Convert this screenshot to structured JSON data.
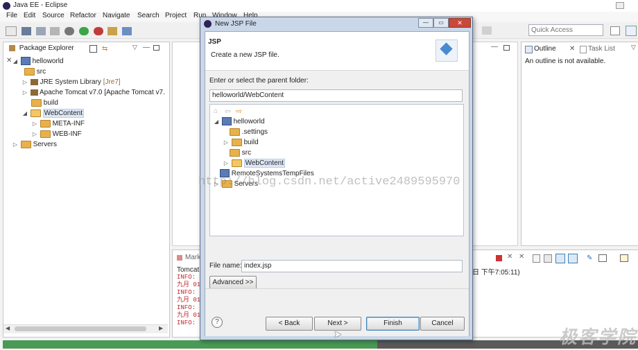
{
  "window": {
    "title": "Java EE - Eclipse"
  },
  "menu": [
    "File",
    "Edit",
    "Source",
    "Refactor",
    "Navigate",
    "Search",
    "Project",
    "Run",
    "Window",
    "Help"
  ],
  "quick_access": {
    "placeholder": "Quick Access"
  },
  "package_explorer": {
    "tab_label": "Package Explorer",
    "tree": [
      {
        "label": "helloworld",
        "suffix": ""
      },
      {
        "label": "src",
        "suffix": ""
      },
      {
        "label": "JRE System Library",
        "suffix": "[Jre7]"
      },
      {
        "label": "Apache Tomcat v7.0 [Apache Tomcat v7.",
        "suffix": ""
      },
      {
        "label": "build",
        "suffix": ""
      },
      {
        "label": "WebContent",
        "suffix": ""
      },
      {
        "label": "META-INF",
        "suffix": ""
      },
      {
        "label": "WEB-INF",
        "suffix": ""
      },
      {
        "label": "Servers",
        "suffix": ""
      }
    ]
  },
  "outline": {
    "tab_label": "Outline",
    "task_tab_label": "Task List",
    "message": "An outline is not available."
  },
  "console": {
    "tab_label": "Mark",
    "header": "Tomcat",
    "header_right": "日 下午7:05:11)",
    "lines": [
      "INFO:",
      "九月 01,",
      "INFO:",
      "九月 01,",
      "INFO:",
      "九月 01,",
      "INFO:"
    ]
  },
  "dialog": {
    "title": "New JSP File",
    "heading": "JSP",
    "subheading": "Create a new JSP file.",
    "folder_label": "Enter or select the parent folder:",
    "folder_value": "helloworld/WebContent",
    "tree": [
      {
        "label": "helloworld"
      },
      {
        "label": ".settings"
      },
      {
        "label": "build"
      },
      {
        "label": "src"
      },
      {
        "label": "WebContent"
      },
      {
        "label": "RemoteSystemsTempFiles"
      },
      {
        "label": "Servers"
      }
    ],
    "file_name_label": "File name:",
    "file_name_value": "index.jsp",
    "advanced_label": "Advanced >>",
    "back_label": "< Back",
    "next_label": "Next >",
    "finish_label": "Finish",
    "cancel_label": "Cancel"
  },
  "watermark": "http://blog.csdn.net/active2489595970",
  "corner_watermark": "极客学院",
  "progress": {
    "fraction": 0.59,
    "color": "#4a9a56"
  }
}
